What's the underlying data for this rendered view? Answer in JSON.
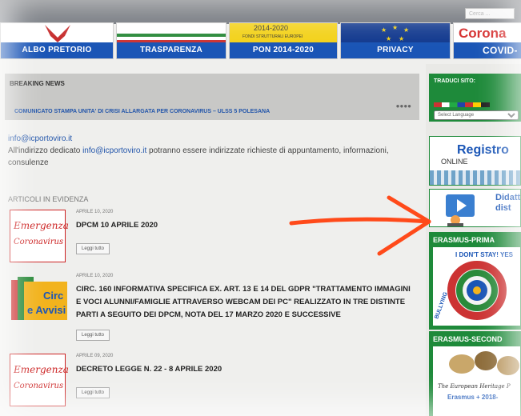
{
  "search": {
    "placeholder": "Cerca ..."
  },
  "banners": [
    {
      "label": "ALBO PRETORIO"
    },
    {
      "label": "TRASPARENZA"
    },
    {
      "label": "PON 2014-2020",
      "img_text": "2014-2020",
      "img_sub": "FONDI STRUTTURALI EUROPEI"
    },
    {
      "label": "PRIVACY"
    },
    {
      "label": "COVID-",
      "img_text": "Corona"
    }
  ],
  "breaking": {
    "title": "BREAKING NEWS",
    "news": "COMUNICATO STAMPA UNITA' DI CRISI ALLARGATA PER CORONAVIRUS – ULSS 5 POLESANA",
    "dots": "●●●●"
  },
  "mail": {
    "address": "info@icportoviro.it",
    "text_pre": "All'indirizzo dedicato ",
    "text_link": "info@icportoviro.it",
    "text_post": " potranno essere indirizzate richieste di appuntamento, informazioni, consulenze"
  },
  "articles_heading": "ARTICOLI IN EVIDENZA",
  "articles": [
    {
      "date": "APRILE 10, 2020",
      "title": "DPCM 10 APRILE 2020",
      "button": "Leggi tutto",
      "thumb_l1": "Emergenza",
      "thumb_l2": "Coronavirus"
    },
    {
      "date": "APRILE 10, 2020",
      "title": "CIRC. 160 INFORMATIVA SPECIFICA EX. ART. 13 E 14 DEL GDPR \"TRATTAMENTO IMMAGINI E VOCI ALUNNI/FAMIGLIE ATTRAVERSO WEBCAM DEI PC\" REALIZZATO IN TRE DISTINTE PARTI A SEGUITO DEI DPCM, NOTA DEL 17 MARZO 2020 E SUCCESSIVE",
      "button": "Leggi tutto",
      "thumb_l1": "Circ",
      "thumb_l2": "e Avvisi"
    },
    {
      "date": "APRILE 09, 2020",
      "title": "DECRETO LEGGE N. 22 - 8 APRILE 2020",
      "button": "Leggi tutto",
      "thumb_l1": "Emergenza",
      "thumb_l2": "Coronavirus"
    }
  ],
  "sidebar": {
    "translate_title": "TRADUCI SITO:",
    "select_language": "Select Language",
    "registro": "Registro",
    "registro_sub": "ONLINE",
    "didattica": "Didatt\ndist",
    "erasmus_primary": "ERASMUS-PRIMA",
    "erasmus_primary_text": "I DON'T STAY! YES",
    "erasmus_primary_side": "BULLYING",
    "erasmus_secondary": "ERASMUS-SECOND",
    "erasmus_secondary_text": "The European Heritage P",
    "erasmus_secondary_sub": "Erasmus + 2018-"
  },
  "colors": {
    "brand_blue": "#1a55b6",
    "green": "#1e8a3a",
    "red": "#c22222",
    "arrow": "#ff4a1a"
  }
}
